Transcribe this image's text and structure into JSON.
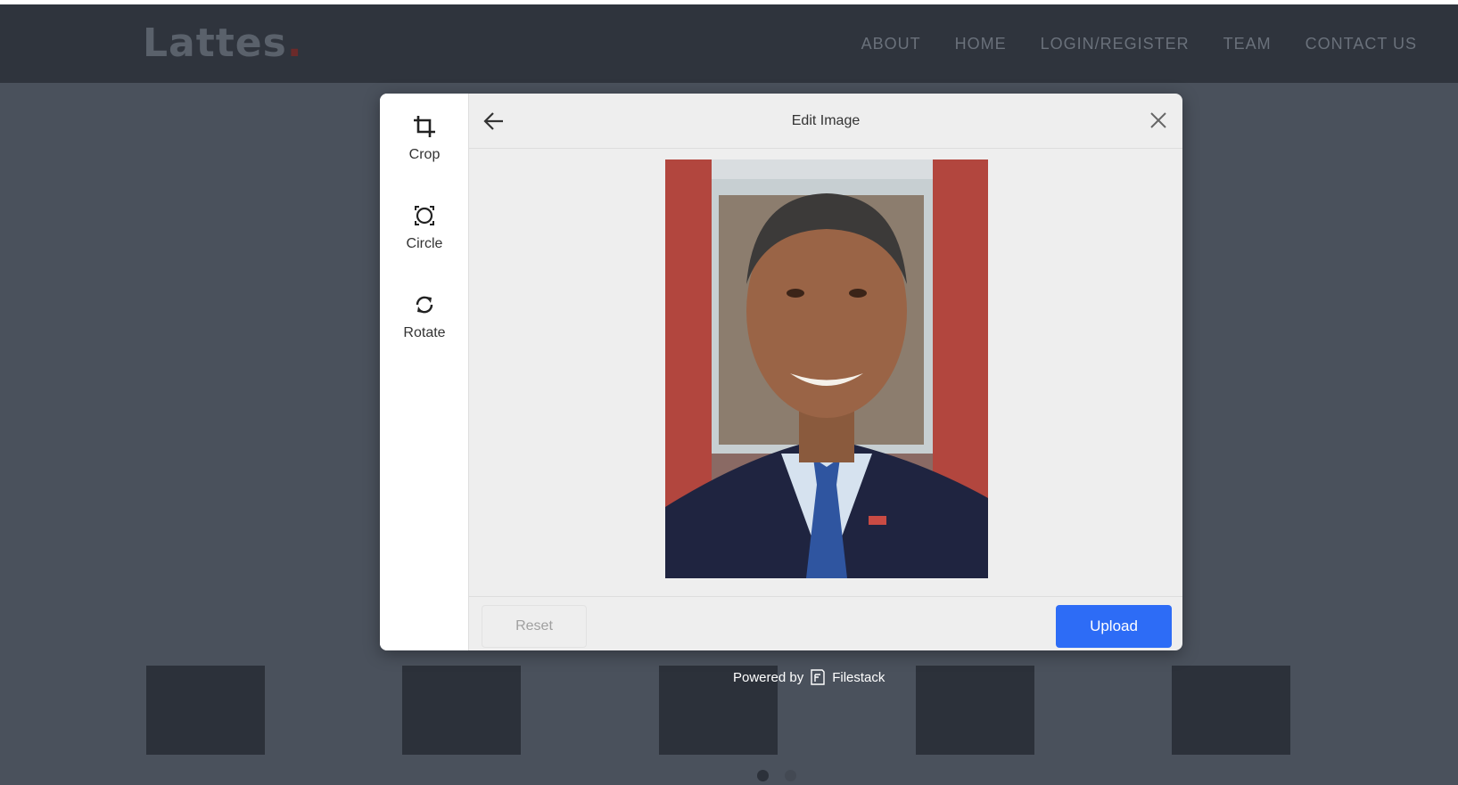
{
  "site": {
    "logo_text": "Lattes",
    "logo_dot": ".",
    "nav": [
      "ABOUT",
      "HOME",
      "LOGIN/REGISTER",
      "TEAM",
      "CONTACT US"
    ]
  },
  "editor": {
    "title": "Edit Image",
    "tools": [
      {
        "label": "Crop",
        "icon": "crop-icon"
      },
      {
        "label": "Circle",
        "icon": "circle-icon"
      },
      {
        "label": "Rotate",
        "icon": "rotate-icon"
      }
    ],
    "back_icon": "arrow-left-icon",
    "close_icon": "close-icon",
    "photo_description_icon": "portrait-photo",
    "reset_label": "Reset",
    "upload_label": "Upload"
  },
  "powered_by": {
    "prefix": "Powered by",
    "brand": "Filestack",
    "icon": "filestack-logo-icon"
  },
  "colors": {
    "upload_button": "#2d6cf6",
    "navbar": "#2f343d",
    "overlay": "#4a515c"
  }
}
